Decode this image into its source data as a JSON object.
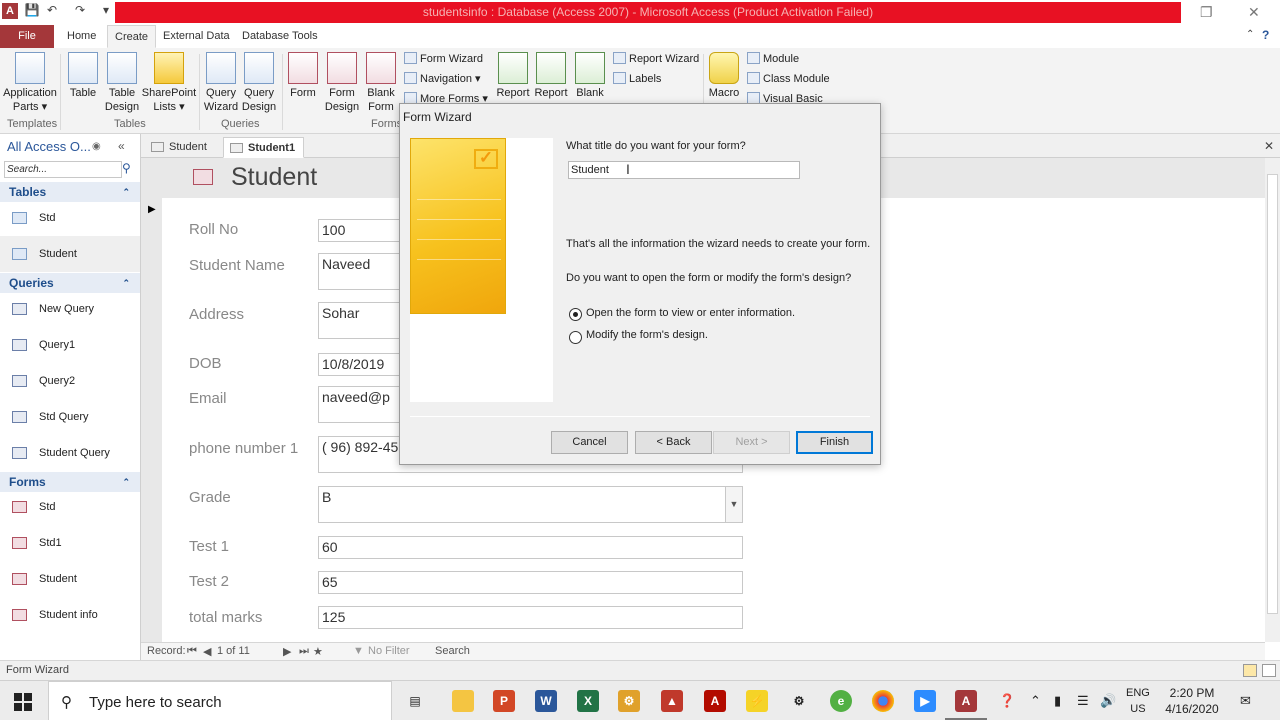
{
  "window": {
    "title": "studentsinfo : Database (Access 2007) - Microsoft Access (Product Activation Failed)",
    "app_icon": "A",
    "minimize": "—",
    "restore": "❐",
    "close": "✕"
  },
  "ribbon_tabs": [
    "File",
    "Home",
    "Create",
    "External Data",
    "Database Tools"
  ],
  "ribbon": {
    "application_parts": "Application Parts ▾",
    "table": "Table",
    "table_design": "Table Design",
    "sharepoint_lists": "SharePoint Lists ▾",
    "query_wizard": "Query Wizard",
    "query_design": "Query Design",
    "form": "Form",
    "form_design": "Form Design",
    "blank_form": "Blank Form",
    "form_wizard": "Form Wizard",
    "navigation": "Navigation ▾",
    "more_forms": "More Forms ▾",
    "report": "Report",
    "report_design": "Report",
    "blank_report": "Blank",
    "report_wizard": "Report Wizard",
    "labels": "Labels",
    "macro": "Macro",
    "module": "Module",
    "class_module": "Class Module",
    "visual_basic": "Visual Basic",
    "groups": [
      "Templates",
      "Tables",
      "Queries",
      "Forms"
    ]
  },
  "nav_pane": {
    "header": "All Access O...",
    "search_placeholder": "Search...",
    "sections": [
      {
        "title": "Tables",
        "items": [
          "Std",
          "Student"
        ]
      },
      {
        "title": "Queries",
        "items": [
          "New Query",
          "Query1",
          "Query2",
          "Std Query",
          "Student Query"
        ]
      },
      {
        "title": "Forms",
        "items": [
          "Std",
          "Std1",
          "Student",
          "Student info"
        ]
      }
    ]
  },
  "doc_tabs": [
    "Student",
    "Student1"
  ],
  "form": {
    "title": "Student",
    "fields": [
      {
        "label": "Roll No",
        "value": "100"
      },
      {
        "label": "Student Name",
        "value": "Naveed"
      },
      {
        "label": "Address",
        "value": "Sohar"
      },
      {
        "label": "DOB",
        "value": "10/8/2019"
      },
      {
        "label": "Email",
        "value": "naveed@p"
      },
      {
        "label": "phone number 1",
        "value": "( 96) 892-45"
      },
      {
        "label": "Grade",
        "value": "B"
      },
      {
        "label": "Test 1",
        "value": "60"
      },
      {
        "label": "Test 2",
        "value": "65"
      },
      {
        "label": "total marks",
        "value": "125"
      }
    ]
  },
  "record_nav": {
    "label": "Record:",
    "position": "1 of 11",
    "filter": "No Filter",
    "search": "Search"
  },
  "wizard": {
    "title": "Form Wizard",
    "question_title": "What title do you want for your form?",
    "title_value": "Student",
    "info": "That's all the information the wizard needs to create your form.",
    "question_open": "Do you want to open the form or modify the form's design?",
    "option_open": "Open the form to view or enter information.",
    "option_modify": "Modify the form's design.",
    "selected_option": "open",
    "buttons": {
      "cancel": "Cancel",
      "back": "< Back",
      "next": "Next >",
      "finish": "Finish"
    }
  },
  "status_bar": {
    "text": "Form Wizard"
  },
  "taskbar": {
    "search_placeholder": "Type here to search",
    "language": "ENG",
    "region": "US",
    "time": "2:20 PM",
    "date": "4/16/2020",
    "apps": [
      "task-view",
      "file-explorer",
      "powerpoint",
      "word",
      "excel",
      "app-icon",
      "app-icon",
      "acrobat",
      "app-icon",
      "app-icon",
      "app-icon",
      "chrome",
      "zoom",
      "access"
    ]
  },
  "colors": {
    "access_brand": "#a4373a",
    "title_bar_alert": "#e81123",
    "nav_section": "#1f4e8b",
    "default_button_border": "#0078d7"
  }
}
